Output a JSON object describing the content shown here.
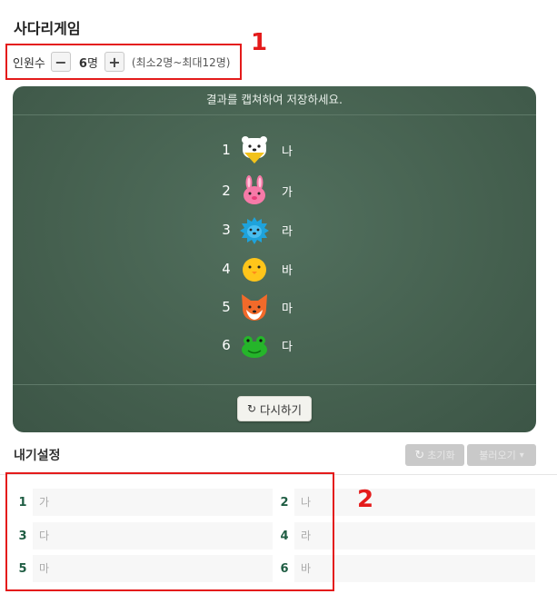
{
  "page": {
    "title": "사다리게임"
  },
  "count": {
    "label": "인원수",
    "minus_symbol": "−",
    "plus_symbol": "+",
    "value": "6",
    "unit": "명",
    "range_text": "(최소2명~최대12명)"
  },
  "board": {
    "header_text": "결과를 캡쳐하여 저장하세요.",
    "results": [
      {
        "num": "1",
        "icon": "polar-bear-icon",
        "name": "나"
      },
      {
        "num": "2",
        "icon": "rabbit-icon",
        "name": "가"
      },
      {
        "num": "3",
        "icon": "hedgehog-icon",
        "name": "라"
      },
      {
        "num": "4",
        "icon": "chick-icon",
        "name": "바"
      },
      {
        "num": "5",
        "icon": "fox-icon",
        "name": "마"
      },
      {
        "num": "6",
        "icon": "frog-icon",
        "name": "다"
      }
    ],
    "reset_label": "다시하기"
  },
  "bet_settings": {
    "title": "내기설정",
    "clear_label": "초기화",
    "preset_label": "불러오기",
    "entries": [
      {
        "num": "1",
        "placeholder": "가"
      },
      {
        "num": "2",
        "placeholder": "나"
      },
      {
        "num": "3",
        "placeholder": "다"
      },
      {
        "num": "4",
        "placeholder": "라"
      },
      {
        "num": "5",
        "placeholder": "마"
      },
      {
        "num": "6",
        "placeholder": "바"
      }
    ]
  },
  "annotations": {
    "one": "1",
    "two": "2"
  },
  "colors": {
    "board_green": "#4a6654",
    "annotation_red": "#e41b1b",
    "number_green": "#1f5d43"
  }
}
